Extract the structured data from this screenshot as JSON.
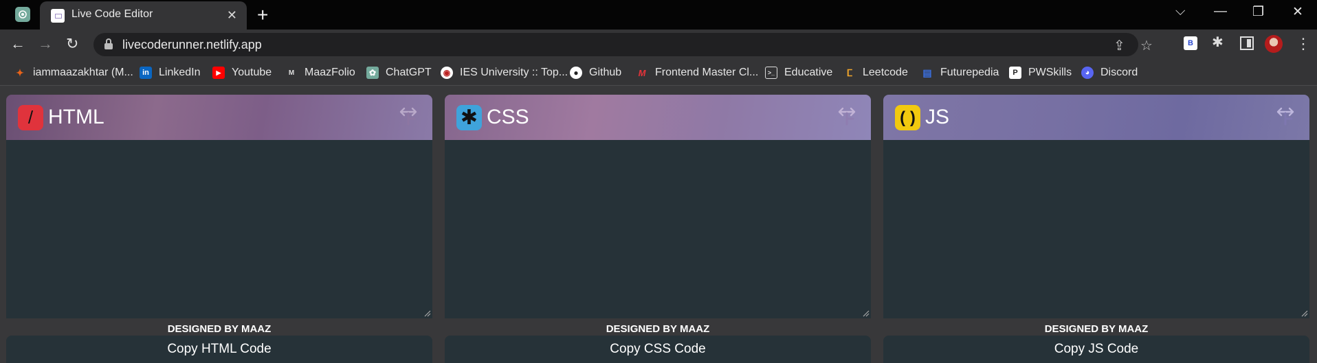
{
  "tabs": {
    "active_title": "Live Code Editor",
    "close_glyph": "✕",
    "new_tab_glyph": "+"
  },
  "window_controls": {
    "search_tabs": "⌵",
    "minimize": "—",
    "restore": "❐",
    "close": "✕"
  },
  "toolbar": {
    "back": "←",
    "forward": "→",
    "reload": "↻",
    "url": "livecoderunner.netlify.app",
    "share": "⇪",
    "star": "☆",
    "ext_b": "B",
    "puzzle": "✱",
    "menu": "⋮"
  },
  "bookmarks": [
    {
      "label": "iammaazakhtar (M...",
      "icon": "blog-icon",
      "color": "#e8631a",
      "glyph": "✦"
    },
    {
      "label": "LinkedIn",
      "icon": "linkedin-icon",
      "color": "#0a66c2",
      "glyph": "in"
    },
    {
      "label": "Youtube",
      "icon": "youtube-icon",
      "color": "#ff0000",
      "glyph": "▶"
    },
    {
      "label": "MaazFolio",
      "icon": "maazfolio-icon",
      "color": "#343436",
      "glyph": "M"
    },
    {
      "label": "ChatGPT",
      "icon": "chatgpt-icon",
      "color": "#74aa9c",
      "glyph": "✿"
    },
    {
      "label": "IES University :: Top...",
      "icon": "ies-icon",
      "color": "#ffffff",
      "glyph": "◉"
    },
    {
      "label": "Github",
      "icon": "github-icon",
      "color": "#343436",
      "glyph": "●"
    },
    {
      "label": "Frontend Master Cl...",
      "icon": "frontend-master-icon",
      "color": "#c8102e",
      "glyph": "M"
    },
    {
      "label": "Educative",
      "icon": "educative-icon",
      "color": "#343436",
      "glyph": ">_"
    },
    {
      "label": "Leetcode",
      "icon": "leetcode-icon",
      "color": "#343436",
      "glyph": "ⵎ"
    },
    {
      "label": "Futurepedia",
      "icon": "futurepedia-icon",
      "color": "#1f4fbf",
      "glyph": "▤"
    },
    {
      "label": "PWSkills",
      "icon": "pwskills-icon",
      "color": "#ffffff",
      "glyph": "P"
    },
    {
      "label": "Discord",
      "icon": "discord-icon",
      "color": "#5865f2",
      "glyph": "◕"
    }
  ],
  "panels": [
    {
      "title": "HTML",
      "icon_glyph": "/",
      "credit": "DESIGNED BY MAAZ",
      "copy_label": "Copy HTML Code"
    },
    {
      "title": "CSS",
      "icon_glyph": "✱",
      "credit": "DESIGNED BY MAAZ",
      "copy_label": "Copy CSS Code"
    },
    {
      "title": "JS",
      "icon_glyph": "( )",
      "credit": "DESIGNED BY MAAZ",
      "copy_label": "Copy JS Code"
    }
  ]
}
